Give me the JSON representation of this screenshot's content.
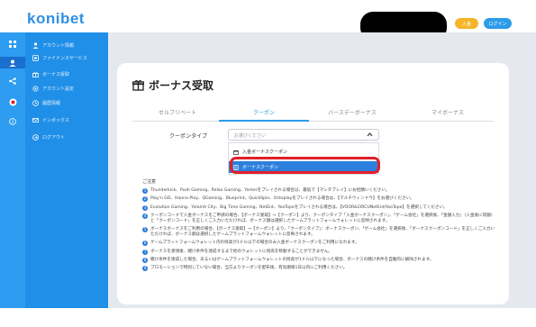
{
  "header": {
    "logo": "konibet",
    "deposit_label": "入金",
    "login_label": "ログイン"
  },
  "sidebar": {
    "items": [
      {
        "label": "アカウント情報",
        "icon": "person-icon"
      },
      {
        "label": "ファイナンスサービス",
        "icon": "finance-icon"
      },
      {
        "label": "ボーナス受取",
        "icon": "gift-icon"
      },
      {
        "label": "アカウント設定",
        "icon": "gear-icon"
      },
      {
        "label": "履歴情報",
        "icon": "clock-icon"
      },
      {
        "label": "インボックス",
        "icon": "mail-icon"
      },
      {
        "label": "ログアウト",
        "icon": "logout-icon"
      }
    ]
  },
  "page": {
    "title": "ボーナス受取",
    "tabs": [
      "セルフリベート",
      "クーポン",
      "バースデーボーナス",
      "マイボーナス"
    ],
    "active_tab": 1,
    "coupon_type_label": "クーポンタイプ",
    "select_placeholder": "お選びください",
    "options": [
      "入金ボーナスクーポン",
      "ボーナスクーポン"
    ],
    "notes_title": "ご注意",
    "notes": [
      "Thunderkick、Push Gaming、Relax Gaming、Yorkerをプレイされる場合は、最低で【マシタプレイ】にお控願いください。",
      "Play'n GO、Hanna Play、QGaming、Blueprint、QuickSpin、Octoplayをプレイされる場合は、【マルチウィンドウ】をお選びください。",
      "Evolution Gaming、Yolomit City、Big Time Gaming、NetEnt、YooTopeをプレイされる場合は、【VOOR&CIRCUNetEnt/YooTope】を選択してください。",
      "クーポンコードで入金ボーナスをご申請の場合、【ボーナス受取】→【クーポン】より、クーポンタイプ「入金ボーナスクーポン」、「ゲーム会社」を選択後、「金額入力」（入金後に同額）と「クーポンコード」を正しくご入力いただければ、ボーナス額は選択したゲームプラットフォームウォレットに反映されます。",
      "ボーナスボーナスをご利用の場合、【ボーナス受取】→【クーポン】より、「クーポンタイプ」：ボーナスクーポン、「ゲーム会社」を選択後、「ボーナスクーポンコード」を正しくご入力いただければ、ボーナス額は選択したゲームプラットフォームウォレットに反映されます。",
      "ゲームプラットフォームウォレット内の残高が1ドル以下の場合のみ入金ボーナスクーポンをご利用になれます。",
      "ボーナスを受領後、賭け条件を達成するまで他のウォレットに残高を移動することができません。",
      "賭け条件を達成した場合、あるいはゲームプラットフォームウォレットの残高が1ドル以下になった場合、ボーナスの賭け条件を自動的に解除されます。",
      "プロモーションで特別していない場合、当方よりクーポンを配布後、有効期限1日以内にご利用ください。"
    ]
  },
  "colors": {
    "brand_blue": "#1f8fe8",
    "active_blue": "#2c9be8",
    "deposit_orange": "#f5b52a",
    "highlight_red": "#e0202a"
  }
}
